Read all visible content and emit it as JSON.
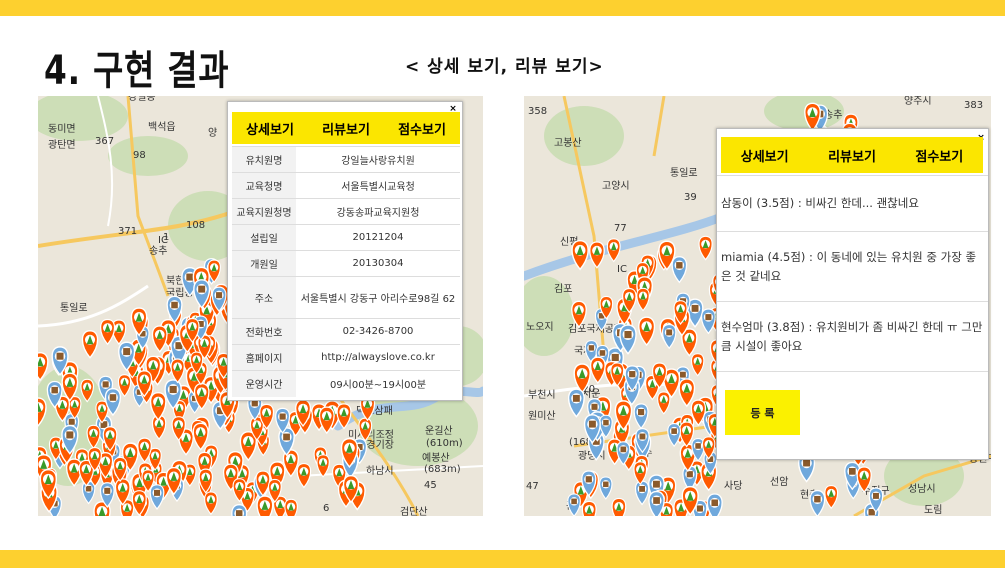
{
  "slide": {
    "title": "4. 구현 결과",
    "subtitle": "< 상세 보기, 리뷰 보기>"
  },
  "colors": {
    "accent": "#fdd02f",
    "tab_bg": "#fbe600",
    "register_bg": "#fbf100",
    "pin_orange": "#ff5a00",
    "pin_blue": "#6fa8dc"
  },
  "left_map": {
    "labels": [
      "강일동",
      "동미면",
      "백석읍",
      "광탄면",
      "367",
      "98",
      "371",
      "1",
      "108",
      "IC",
      "송추",
      "북한산",
      "국립공원",
      "통일로",
      "양",
      "덕소삼패",
      "미사리조정",
      "카누경기장",
      "하남시",
      "운길산",
      "(610m)",
      "예봉산",
      "(683m)",
      "45",
      "검단산",
      "6"
    ],
    "popup": {
      "close": "×",
      "tabs": [
        "상세보기",
        "리뷰보기",
        "점수보기"
      ],
      "rows": [
        {
          "key": "유치원명",
          "value": "강일늘사랑유치원"
        },
        {
          "key": "교육청명",
          "value": "서울특별시교육청"
        },
        {
          "key": "교육지원청명",
          "value": "강동송파교육지원청"
        },
        {
          "key": "설립일",
          "value": "20121204"
        },
        {
          "key": "개원일",
          "value": "20130304"
        },
        {
          "key": "주소",
          "value": "서울특별시 강동구 아리수로98길 62"
        },
        {
          "key": "전화번호",
          "value": "02-3426-8700"
        },
        {
          "key": "홈페이지",
          "value": "http://alwayslove.co.kr"
        },
        {
          "key": "운영시간",
          "value": "09시00분~19시00분"
        }
      ]
    }
  },
  "right_map": {
    "labels": [
      "358",
      "송추",
      "고봉산",
      "고양시",
      "통일로",
      "39",
      "77",
      "IC",
      "신평",
      "김포",
      "노오지",
      "김포국제공항",
      "국제선",
      "120",
      "서운",
      "부천시",
      "원미산",
      "(168m)",
      "광명시",
      "장수",
      "47",
      "관악",
      "사당",
      "선암",
      "현충",
      "수정구",
      "성남시",
      "도림",
      "중원구",
      "양주시",
      "383"
    ],
    "popup": {
      "close": "×",
      "tabs": [
        "상세보기",
        "리뷰보기",
        "점수보기"
      ],
      "reviews": [
        "삼동이 (3.5점) : 비싸긴 한데... 괜찮네요",
        "miamia (4.5점) : 이 동네에 있는 유치원 중 가장 좋은 것 같네요",
        "현수엄마 (3.8점) : 유치원비가 좀 비싸긴 한데 ㅠ 그만큼 시설이 좋아요"
      ],
      "register_label": "등 록"
    }
  }
}
